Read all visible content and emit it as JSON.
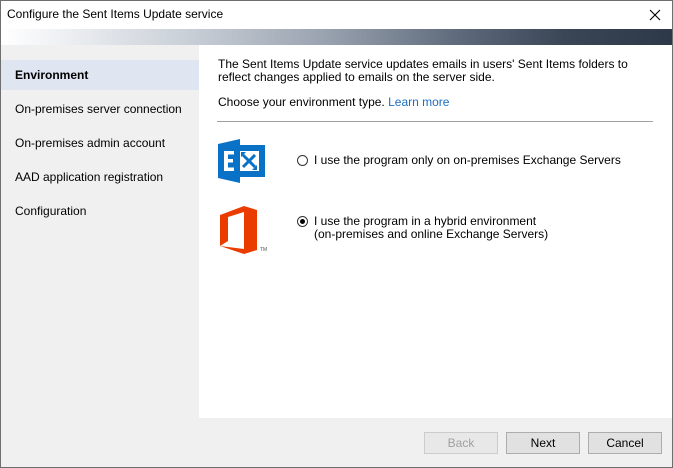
{
  "window": {
    "title": "Configure the Sent Items Update service",
    "close_icon": "close-icon"
  },
  "sidebar": {
    "items": [
      {
        "label": "Environment",
        "active": true
      },
      {
        "label": "On-premises server connection",
        "active": false
      },
      {
        "label": "On-premises admin account",
        "active": false
      },
      {
        "label": "AAD application registration",
        "active": false
      },
      {
        "label": "Configuration",
        "active": false
      }
    ]
  },
  "main": {
    "description": "The Sent Items Update service updates emails in users' Sent Items folders to reflect changes applied to emails on the server side.",
    "environment_prompt": "Choose your environment type.",
    "learn_more": "Learn more",
    "options": [
      {
        "label_line1": "I use the program only on on-premises Exchange Servers",
        "label_line2": "",
        "checked": false,
        "icon": "exchange-icon",
        "color": "#0a72c6"
      },
      {
        "label_line1": "I use the program in a hybrid environment",
        "label_line2": "(on-premises and online Exchange Servers)",
        "checked": true,
        "icon": "office-icon",
        "color": "#eb3c00",
        "icon_text": "TM"
      }
    ]
  },
  "footer": {
    "back_label": "Back",
    "next_label": "Next",
    "cancel_label": "Cancel",
    "back_enabled": false
  }
}
